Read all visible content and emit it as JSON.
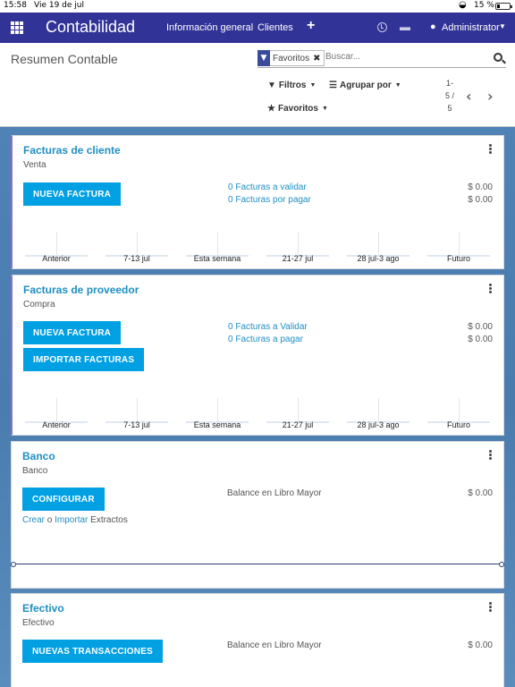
{
  "status_bar": {
    "time": "15:58",
    "date": "Vie 19 de jul",
    "battery_pct": "15 %",
    "battery_level": 0.15
  },
  "navbar": {
    "app_title": "Contabilidad",
    "menu": [
      "Información general",
      "Clientes"
    ],
    "plus": "+",
    "user": "Administrator",
    "icons": [
      "apps-grid-icon",
      "clock-icon",
      "chat-icon",
      "user-icon"
    ]
  },
  "control_panel": {
    "breadcrumb": "Resumen Contable",
    "search": {
      "facet_label": "Favoritos",
      "placeholder": "Buscar..."
    },
    "filters_label": "Filtros",
    "group_by_label": "Agrupar por",
    "favorites_label": "Favoritos",
    "pager": {
      "line1": "1-",
      "line2": "5 /",
      "line3": "5"
    }
  },
  "colors": {
    "navbar_bg": "#323396",
    "accent_button": "#00a0e3",
    "link": "#1f8fc2",
    "background": "#4f82b5"
  },
  "cards": [
    {
      "title": "Facturas de cliente",
      "subtitle": "Venta",
      "buttons": [
        "NUEVA FACTURA"
      ],
      "rows": [
        {
          "label": "0 Facturas a validar",
          "amount": "$ 0.00"
        },
        {
          "label": "0 Facturas por pagar",
          "amount": "$ 0.00"
        }
      ],
      "graph_labels": [
        "Anterior",
        "7-13 jul",
        "Esta semana",
        "21-27 jul",
        "28 jul-3 ago",
        "Futuro"
      ]
    },
    {
      "title": "Facturas de proveedor",
      "subtitle": "Compra",
      "buttons": [
        "NUEVA FACTURA",
        "IMPORTAR FACTURAS"
      ],
      "rows": [
        {
          "label": "0 Facturas a Validar",
          "amount": "$ 0.00"
        },
        {
          "label": "0 Facturas a pagar",
          "amount": "$ 0.00"
        }
      ],
      "graph_labels": [
        "Anterior",
        "7-13 jul",
        "Esta semana",
        "21-27 jul",
        "28 jul-3 ago",
        "Futuro"
      ]
    },
    {
      "title": "Banco",
      "subtitle": "Banco",
      "buttons": [
        "CONFIGURAR"
      ],
      "balance_label": "Balance en Libro Mayor",
      "amount": "$ 0.00",
      "create_link": "Crear",
      "or_text": "o",
      "import_link": "Importar",
      "statements_text": "Extractos"
    },
    {
      "title": "Efectivo",
      "subtitle": "Efectivo",
      "buttons": [
        "NUEVAS TRANSACCIONES"
      ],
      "balance_label": "Balance en Libro Mayor",
      "amount": "$ 0.00"
    }
  ]
}
